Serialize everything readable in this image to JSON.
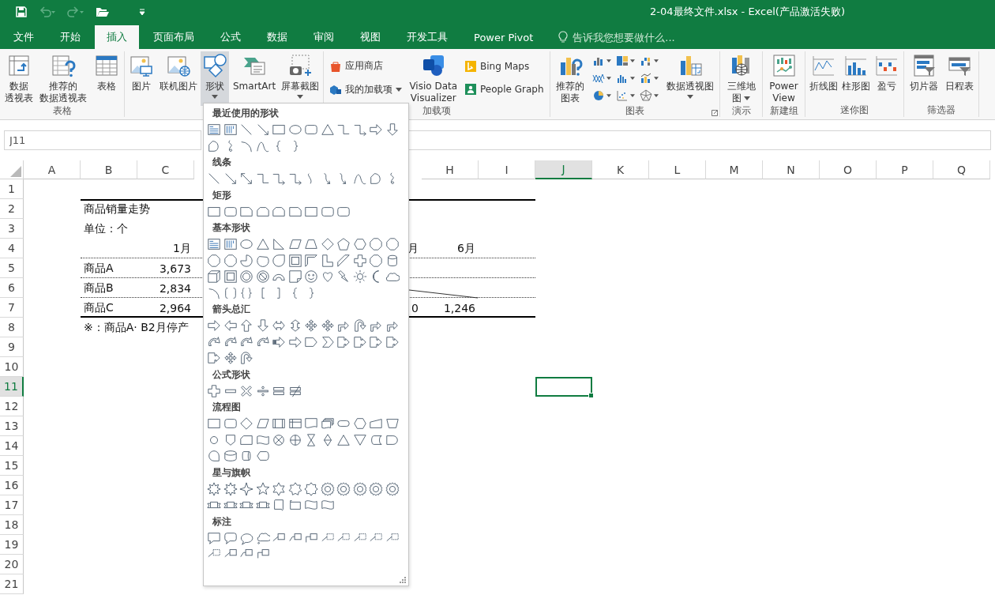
{
  "quick_access": [
    {
      "disabled": false
    },
    {
      "disabled": true
    },
    {
      "disabled": true
    },
    {
      "disabled": false
    }
  ],
  "window": {
    "title": "2-04最终文件.xlsx - Excel(产品激活失败)"
  },
  "tabs": [
    {
      "label": "文件",
      "selected": false
    },
    {
      "label": "开始",
      "selected": false
    },
    {
      "label": "插入",
      "selected": true
    },
    {
      "label": "页面布局",
      "selected": false
    },
    {
      "label": "公式",
      "selected": false
    },
    {
      "label": "数据",
      "selected": false
    },
    {
      "label": "审阅",
      "selected": false
    },
    {
      "label": "视图",
      "selected": false
    },
    {
      "label": "开发工具",
      "selected": false
    },
    {
      "label": "Power Pivot",
      "selected": false
    }
  ],
  "tell_me": {
    "placeholder": "告诉我您想要做什么..."
  },
  "ribbon": {
    "groups": [
      {
        "label": "表格",
        "items": [
          {
            "kind": "large",
            "lines": [
              "数据",
              "透视表"
            ],
            "pressed": false
          },
          {
            "kind": "large",
            "lines": [
              "推荐的",
              "数据透视表"
            ],
            "pressed": false
          },
          {
            "kind": "large",
            "lines": [
              "表格"
            ],
            "pressed": false
          }
        ]
      },
      {
        "items": [
          {
            "kind": "large",
            "lines": [
              "图片"
            ],
            "pressed": false
          },
          {
            "kind": "large",
            "lines": [
              "联机图片"
            ],
            "pressed": false
          },
          {
            "kind": "large",
            "lines": [
              "形状"
            ],
            "dropdown": true,
            "pressed": true
          },
          {
            "kind": "large",
            "lines": [
              "SmartArt"
            ],
            "pressed": false
          },
          {
            "kind": "large",
            "lines": [
              "屏幕截图"
            ],
            "dropdown": true,
            "pressed": false
          }
        ]
      },
      {
        "label": "加载项",
        "items": [
          {
            "kind": "stack",
            "entries": [
              {
                "label": "应用商店"
              },
              {
                "label": "我的加载项",
                "dropdown": true
              }
            ]
          },
          {
            "kind": "large",
            "lines": [
              "Visio Data",
              "Visualizer"
            ],
            "pressed": false
          },
          {
            "kind": "stack",
            "entries": [
              {
                "label": "Bing Maps"
              },
              {
                "label": "People Graph"
              }
            ]
          }
        ]
      },
      {
        "label": "图表",
        "launcher": true,
        "items": [
          {
            "kind": "large",
            "lines": [
              "推荐的",
              "图表"
            ],
            "pressed": false
          },
          {
            "kind": "grid",
            "buttons": [
              {
                "dropdown": true
              },
              {
                "dropdown": true
              },
              {
                "dropdown": true
              },
              {
                "dropdown": true
              },
              {
                "dropdown": true
              },
              {
                "dropdown": true
              },
              {
                "dropdown": true
              },
              {
                "dropdown": true
              },
              {
                "dropdown": true
              }
            ]
          },
          {
            "kind": "large",
            "lines": [
              "数据透视图"
            ],
            "dropdown": true,
            "pressed": false
          }
        ]
      },
      {
        "label": "演示",
        "items": [
          {
            "kind": "large",
            "lines": [
              "三维地",
              "图"
            ],
            "dropdown": true,
            "pressed": false
          }
        ]
      },
      {
        "label": "新建组",
        "items": [
          {
            "kind": "large",
            "lines": [
              "Power",
              "View"
            ],
            "pressed": false
          }
        ]
      },
      {
        "label": "迷你图",
        "items": [
          {
            "kind": "large",
            "lines": [
              "折线图"
            ],
            "pressed": false
          },
          {
            "kind": "large",
            "lines": [
              "柱形图"
            ],
            "pressed": false
          },
          {
            "kind": "large",
            "lines": [
              "盈亏"
            ],
            "pressed": false
          }
        ]
      },
      {
        "label": "筛选器",
        "items": [
          {
            "kind": "large",
            "lines": [
              "切片器"
            ],
            "pressed": false
          },
          {
            "kind": "large",
            "lines": [
              "日程表"
            ],
            "pressed": false
          }
        ]
      }
    ]
  },
  "name_box": {
    "value": "J11"
  },
  "sheet": {
    "columns": [
      {
        "kind": "header",
        "label": "A",
        "selected": false
      },
      {
        "kind": "header",
        "label": "B",
        "selected": false
      },
      {
        "kind": "header",
        "label": "C",
        "selected": false
      },
      {
        "kind": "covered"
      },
      {
        "kind": "covered"
      },
      {
        "kind": "covered"
      },
      {
        "kind": "covered"
      },
      {
        "kind": "header",
        "label": "H",
        "selected": false
      },
      {
        "kind": "header",
        "label": "I",
        "selected": false
      },
      {
        "kind": "header",
        "label": "J",
        "selected": true
      },
      {
        "kind": "header",
        "label": "K",
        "selected": false
      },
      {
        "kind": "header",
        "label": "L",
        "selected": false
      },
      {
        "kind": "header",
        "label": "M",
        "selected": false
      },
      {
        "kind": "header",
        "label": "N",
        "selected": false
      },
      {
        "kind": "header",
        "label": "O",
        "selected": false
      },
      {
        "kind": "header",
        "label": "P",
        "selected": false
      },
      {
        "kind": "header",
        "label": "Q",
        "selected": false
      }
    ],
    "rows": [
      {
        "label": "1",
        "selected": false
      },
      {
        "label": "2",
        "selected": false,
        "thick_rule_above": true,
        "cells": [
          {
            "kind": "blank"
          },
          {
            "kind": "text",
            "text": "商品销量走势"
          }
        ]
      },
      {
        "label": "3",
        "selected": false,
        "cells": [
          {
            "kind": "blank"
          },
          {
            "kind": "text",
            "text": "单位：个"
          }
        ]
      },
      {
        "label": "4",
        "selected": false,
        "dotted_rule_below": true,
        "cells": [
          {
            "kind": "blank"
          },
          {
            "kind": "blank"
          },
          {
            "kind": "number",
            "text": "1月"
          },
          {
            "kind": "blank"
          },
          {
            "kind": "blank"
          },
          {
            "kind": "blank"
          },
          {
            "kind": "number",
            "text": "月"
          },
          {
            "kind": "number",
            "text": "6月"
          }
        ]
      },
      {
        "label": "5",
        "selected": false,
        "dotted_rule_below": true,
        "cells": [
          {
            "kind": "blank"
          },
          {
            "kind": "text",
            "text": "商品A"
          },
          {
            "kind": "number",
            "text": "3,673"
          }
        ]
      },
      {
        "label": "6",
        "selected": false,
        "dotted_rule_below": true,
        "cells": [
          {
            "kind": "blank"
          },
          {
            "kind": "text",
            "text": "商品B"
          },
          {
            "kind": "number",
            "text": "2,834"
          }
        ]
      },
      {
        "label": "7",
        "selected": false,
        "thick_rule_below": true,
        "cells": [
          {
            "kind": "blank"
          },
          {
            "kind": "text",
            "text": "商品C"
          },
          {
            "kind": "number",
            "text": "2,964"
          },
          {
            "kind": "blank"
          },
          {
            "kind": "blank"
          },
          {
            "kind": "blank"
          },
          {
            "kind": "number",
            "text": "0"
          },
          {
            "kind": "number",
            "text": "1,246"
          }
        ]
      },
      {
        "label": "8",
        "selected": false,
        "cells": [
          {
            "kind": "blank"
          },
          {
            "kind": "text",
            "text": "※：商品A· B2月停产"
          }
        ]
      },
      {
        "label": "9",
        "selected": false
      },
      {
        "label": "10",
        "selected": false
      },
      {
        "label": "11",
        "selected": true
      },
      {
        "label": "12",
        "selected": false
      },
      {
        "label": "13",
        "selected": false
      },
      {
        "label": "14",
        "selected": false
      },
      {
        "label": "15",
        "selected": false
      },
      {
        "label": "16",
        "selected": false
      },
      {
        "label": "17",
        "selected": false
      },
      {
        "label": "18",
        "selected": false
      },
      {
        "label": "19",
        "selected": false
      },
      {
        "label": "20",
        "selected": false
      },
      {
        "label": "21",
        "selected": false
      }
    ]
  },
  "shapes_menu": {
    "sections": [
      {
        "title": "最近使用的形状",
        "shapes": [
          {
            "kind": "textbox"
          },
          {
            "kind": "vtextbox"
          },
          {
            "kind": "line"
          },
          {
            "kind": "arrowline"
          },
          {
            "kind": "rect"
          },
          {
            "kind": "oval"
          },
          {
            "kind": "roundrect"
          },
          {
            "kind": "triangle"
          },
          {
            "kind": "elbow"
          },
          {
            "kind": "elbowarrow"
          },
          {
            "kind": "rarrow"
          },
          {
            "kind": "darrow"
          },
          {
            "kind": "freeform"
          },
          {
            "kind": "scribble"
          },
          {
            "kind": "arc"
          },
          {
            "kind": "wave"
          },
          {
            "kind": "lbrace"
          },
          {
            "kind": "rbrace"
          }
        ]
      },
      {
        "title": "线条",
        "shapes": [
          {
            "kind": "line"
          },
          {
            "kind": "arrowline"
          },
          {
            "kind": "dblarrow"
          },
          {
            "kind": "elbow"
          },
          {
            "kind": "elbowarrow"
          },
          {
            "kind": "elbowarrow"
          },
          {
            "kind": "curve"
          },
          {
            "kind": "curvearrow"
          },
          {
            "kind": "curvearrow"
          },
          {
            "kind": "wave"
          },
          {
            "kind": "freeform"
          },
          {
            "kind": "scribble"
          }
        ]
      },
      {
        "title": "矩形",
        "shapes": [
          {
            "kind": "rect"
          },
          {
            "kind": "roundrect"
          },
          {
            "kind": "snip"
          },
          {
            "kind": "snip2"
          },
          {
            "kind": "snip2"
          },
          {
            "kind": "snip"
          },
          {
            "kind": "rect"
          },
          {
            "kind": "roundrect"
          },
          {
            "kind": "roundrect"
          }
        ]
      },
      {
        "title": "基本形状",
        "shapes": [
          {
            "kind": "textbox"
          },
          {
            "kind": "vtextbox"
          },
          {
            "kind": "oval"
          },
          {
            "kind": "triangle"
          },
          {
            "kind": "rtriangle"
          },
          {
            "kind": "parallelogram"
          },
          {
            "kind": "trapezoid"
          },
          {
            "kind": "diamond"
          },
          {
            "kind": "pentagon"
          },
          {
            "kind": "hexagon"
          },
          {
            "kind": "octagon"
          },
          {
            "kind": "octagon"
          },
          {
            "kind": "octagon"
          },
          {
            "kind": "octagon"
          },
          {
            "kind": "pie"
          },
          {
            "kind": "chord"
          },
          {
            "kind": "teardrop"
          },
          {
            "kind": "frame"
          },
          {
            "kind": "halfframe"
          },
          {
            "kind": "lshape"
          },
          {
            "kind": "diagstripe"
          },
          {
            "kind": "plus"
          },
          {
            "kind": "octagon"
          },
          {
            "kind": "cylinder"
          },
          {
            "kind": "cube"
          },
          {
            "kind": "frame"
          },
          {
            "kind": "donut"
          },
          {
            "kind": "nosymbol"
          },
          {
            "kind": "blockarc"
          },
          {
            "kind": "folded"
          },
          {
            "kind": "smiley"
          },
          {
            "kind": "heart"
          },
          {
            "kind": "lightning"
          },
          {
            "kind": "sun"
          },
          {
            "kind": "moon"
          },
          {
            "kind": "cloud"
          },
          {
            "kind": "arc"
          },
          {
            "kind": "bracketpair"
          },
          {
            "kind": "bracepair"
          },
          {
            "kind": "lbracket"
          },
          {
            "kind": "rbracket"
          },
          {
            "kind": "lbrace"
          },
          {
            "kind": "rbrace"
          }
        ]
      },
      {
        "title": "箭头总汇",
        "shapes": [
          {
            "kind": "rarrow"
          },
          {
            "kind": "larrow"
          },
          {
            "kind": "uarrow"
          },
          {
            "kind": "darrow"
          },
          {
            "kind": "lrarrow"
          },
          {
            "kind": "udarrow"
          },
          {
            "kind": "quadarrow"
          },
          {
            "kind": "quadarrow"
          },
          {
            "kind": "bentarrow"
          },
          {
            "kind": "uturn"
          },
          {
            "kind": "bentarrow"
          },
          {
            "kind": "bentarrow"
          },
          {
            "kind": "curvedarrow"
          },
          {
            "kind": "curvedarrow"
          },
          {
            "kind": "curvedarrow"
          },
          {
            "kind": "curvedarrow"
          },
          {
            "kind": "striped"
          },
          {
            "kind": "rarrow"
          },
          {
            "kind": "homeplate"
          },
          {
            "kind": "chevron"
          },
          {
            "kind": "arrowcallout"
          },
          {
            "kind": "arrowcallout"
          },
          {
            "kind": "arrowcallout"
          },
          {
            "kind": "arrowcallout"
          },
          {
            "kind": "arrowcallout"
          },
          {
            "kind": "quadarrow"
          },
          {
            "kind": "uturn"
          }
        ]
      },
      {
        "title": "公式形状",
        "shapes": [
          {
            "kind": "plus"
          },
          {
            "kind": "minus"
          },
          {
            "kind": "times"
          },
          {
            "kind": "divide"
          },
          {
            "kind": "equal"
          },
          {
            "kind": "notequal"
          }
        ]
      },
      {
        "title": "流程图",
        "shapes": [
          {
            "kind": "rect"
          },
          {
            "kind": "roundrect"
          },
          {
            "kind": "diamond"
          },
          {
            "kind": "parallelogram"
          },
          {
            "kind": "predefined"
          },
          {
            "kind": "internal"
          },
          {
            "kind": "document"
          },
          {
            "kind": "multidoc"
          },
          {
            "kind": "terminator"
          },
          {
            "kind": "hexagon"
          },
          {
            "kind": "manualinput"
          },
          {
            "kind": "manualop"
          },
          {
            "kind": "circle"
          },
          {
            "kind": "offpage"
          },
          {
            "kind": "card"
          },
          {
            "kind": "tape"
          },
          {
            "kind": "sumjunction"
          },
          {
            "kind": "orjunction"
          },
          {
            "kind": "collate"
          },
          {
            "kind": "sort"
          },
          {
            "kind": "triangle"
          },
          {
            "kind": "merge"
          },
          {
            "kind": "storeddata"
          },
          {
            "kind": "delay"
          },
          {
            "kind": "seqaccess"
          },
          {
            "kind": "disk"
          },
          {
            "kind": "directaccess"
          },
          {
            "kind": "display"
          }
        ]
      },
      {
        "title": "星与旗帜",
        "shapes": [
          {
            "kind": "burst"
          },
          {
            "kind": "burst"
          },
          {
            "kind": "star4"
          },
          {
            "kind": "star5"
          },
          {
            "kind": "star6"
          },
          {
            "kind": "star7"
          },
          {
            "kind": "star8"
          },
          {
            "kind": "seal"
          },
          {
            "kind": "seal"
          },
          {
            "kind": "seal"
          },
          {
            "kind": "seal"
          },
          {
            "kind": "seal"
          },
          {
            "kind": "ribbon"
          },
          {
            "kind": "ribbon"
          },
          {
            "kind": "ribbon"
          },
          {
            "kind": "ribbon"
          },
          {
            "kind": "scroll"
          },
          {
            "kind": "hscroll"
          },
          {
            "kind": "wavyflag"
          },
          {
            "kind": "wavyflag"
          }
        ]
      },
      {
        "title": "标注",
        "shapes": [
          {
            "kind": "callout-rect"
          },
          {
            "kind": "callout-round"
          },
          {
            "kind": "callout-oval"
          },
          {
            "kind": "callout-cloud"
          },
          {
            "kind": "callout-line"
          },
          {
            "kind": "callout-line2"
          },
          {
            "kind": "callout-line3"
          },
          {
            "kind": "callout-dash"
          },
          {
            "kind": "callout-dash"
          },
          {
            "kind": "callout-dash"
          },
          {
            "kind": "callout-dash"
          },
          {
            "kind": "callout-dash"
          },
          {
            "kind": "callout-dash"
          },
          {
            "kind": "callout-line"
          },
          {
            "kind": "callout-line2"
          },
          {
            "kind": "callout-line3"
          }
        ]
      }
    ]
  }
}
